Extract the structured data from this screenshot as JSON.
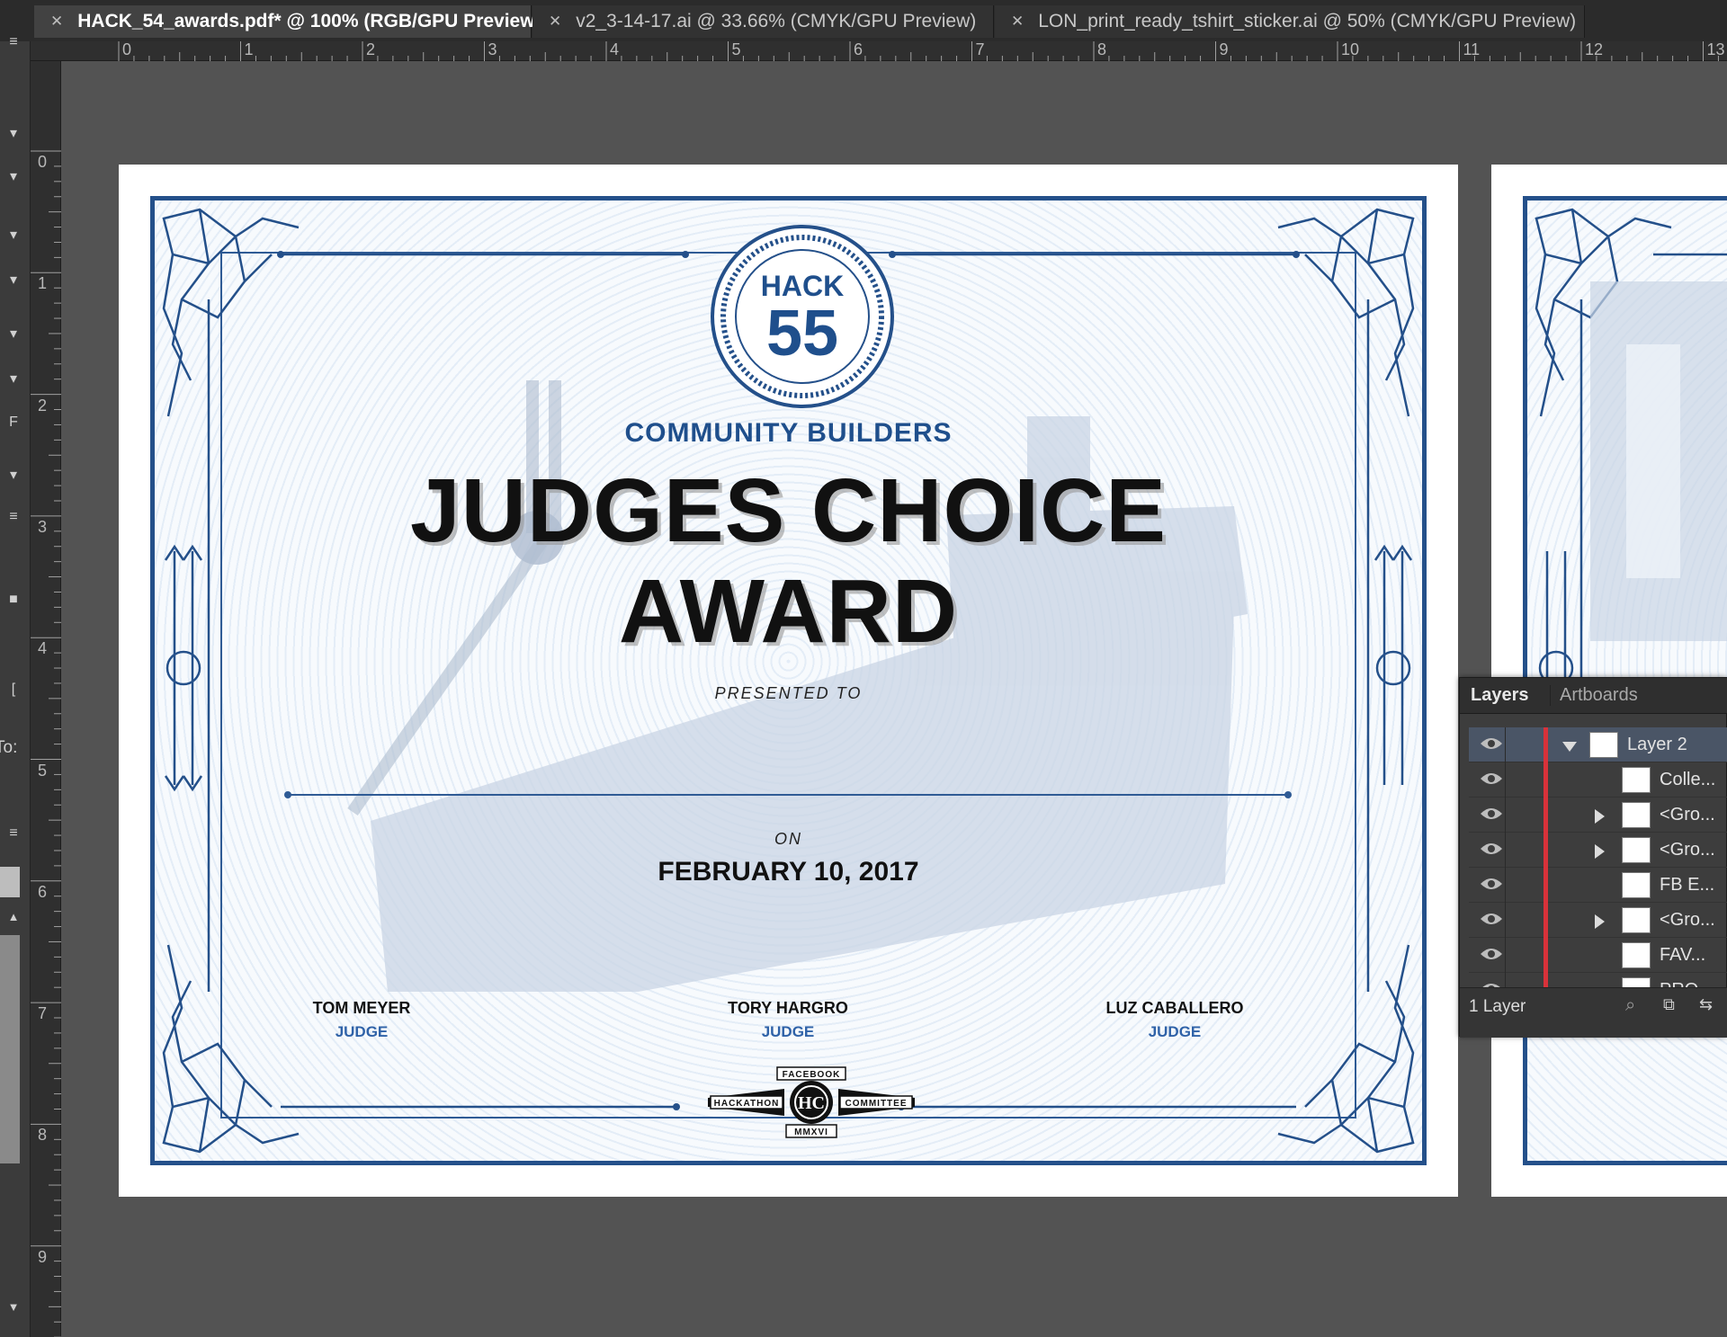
{
  "tabs": [
    {
      "label": "HACK_54_awards.pdf* @ 100% (RGB/GPU Preview)",
      "active": true
    },
    {
      "label": "v2_3-14-17.ai @ 33.66% (CMYK/GPU Preview)",
      "active": false
    },
    {
      "label": "LON_print_ready_tshirt_sticker.ai @ 50% (CMYK/GPU Preview)",
      "active": false
    }
  ],
  "ruler": {
    "top_numbers": [
      "0",
      "1",
      "2",
      "3",
      "4",
      "5",
      "6",
      "7",
      "8",
      "9",
      "10",
      "11",
      "12",
      "13"
    ],
    "left_numbers": [
      "0",
      "1",
      "2",
      "3",
      "4",
      "5",
      "6",
      "7",
      "8",
      "9"
    ]
  },
  "leftbar": {
    "to_label": "To:"
  },
  "certificate": {
    "seal_top": "HACK",
    "seal_number": "55",
    "category": "COMMUNITY BUILDERS",
    "title_line1": "JUDGES CHOICE",
    "title_line2": "AWARD",
    "presented_to": "PRESENTED TO",
    "on_label": "ON",
    "date": "FEBRUARY 10, 2017",
    "judges": [
      {
        "name": "TOM MEYER",
        "role": "JUDGE"
      },
      {
        "name": "TORY HARGRO",
        "role": "JUDGE"
      },
      {
        "name": "LUZ CABALLERO",
        "role": "JUDGE"
      }
    ],
    "footer_logo": {
      "top": "FACEBOOK",
      "left": "HACKATHON",
      "right": "COMMITTEE",
      "bottom": "MMXVI"
    },
    "accent_color": "#24508a"
  },
  "layers_panel": {
    "tabs": [
      "Layers",
      "Artboards"
    ],
    "rows": [
      {
        "name": "Layer 2",
        "expanded": true,
        "selected": true
      },
      {
        "name": "Colle...",
        "expandable": false
      },
      {
        "name": "<Gro...",
        "expandable": true
      },
      {
        "name": "<Gro...",
        "expandable": true
      },
      {
        "name": "FB E...",
        "expandable": false
      },
      {
        "name": "<Gro...",
        "expandable": true
      },
      {
        "name": "FAV...",
        "expandable": false
      },
      {
        "name": "PRO...",
        "expandable": false
      }
    ],
    "footer_count": "1 Layer"
  }
}
